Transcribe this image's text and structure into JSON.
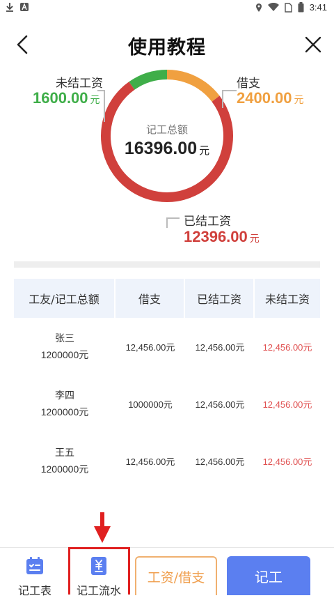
{
  "status": {
    "time": "3:41"
  },
  "header": {
    "title": "使用教程"
  },
  "summary": {
    "center_label": "记工总额",
    "center_value": "16396.00",
    "unit": "元",
    "unpaid": {
      "label": "未结工资",
      "value": "1600.00",
      "color": "#3fae49"
    },
    "borrow": {
      "label": "借支",
      "value": "2400.00",
      "color": "#f0a040"
    },
    "paid": {
      "label": "已结工资",
      "value": "12396.00",
      "color": "#d0403c"
    }
  },
  "chart_data": {
    "type": "pie",
    "categories": [
      "未结工资",
      "借支",
      "已结工资"
    ],
    "values": [
      1600.0,
      2400.0,
      12396.0
    ],
    "colors": [
      "#3fae49",
      "#f0a040",
      "#d0403c"
    ]
  },
  "table": {
    "headers": [
      "工友/记工总额",
      "借支",
      "已结工资",
      "未结工资"
    ],
    "rows": [
      {
        "name": "张三",
        "total": "1200000元",
        "borrow": "12,456.00元",
        "paid": "12,456.00元",
        "unpaid": "12,456.00元"
      },
      {
        "name": "李四",
        "total": "1200000元",
        "borrow": "1000000元",
        "paid": "12,456.00元",
        "unpaid": "12,456.00元"
      },
      {
        "name": "王五",
        "total": "1200000元",
        "borrow": "12,456.00元",
        "paid": "12,456.00元",
        "unpaid": "12,456.00元"
      }
    ]
  },
  "bottom": {
    "tab_record_sheet": "记工表",
    "tab_record_flow": "记工流水",
    "salary_button": "工资/借支",
    "record_button": "记工"
  },
  "colors": {
    "accent_blue": "#5b7ff0",
    "orange": "#f0a050",
    "red_value": "#e05050",
    "highlight": "#e02020"
  }
}
